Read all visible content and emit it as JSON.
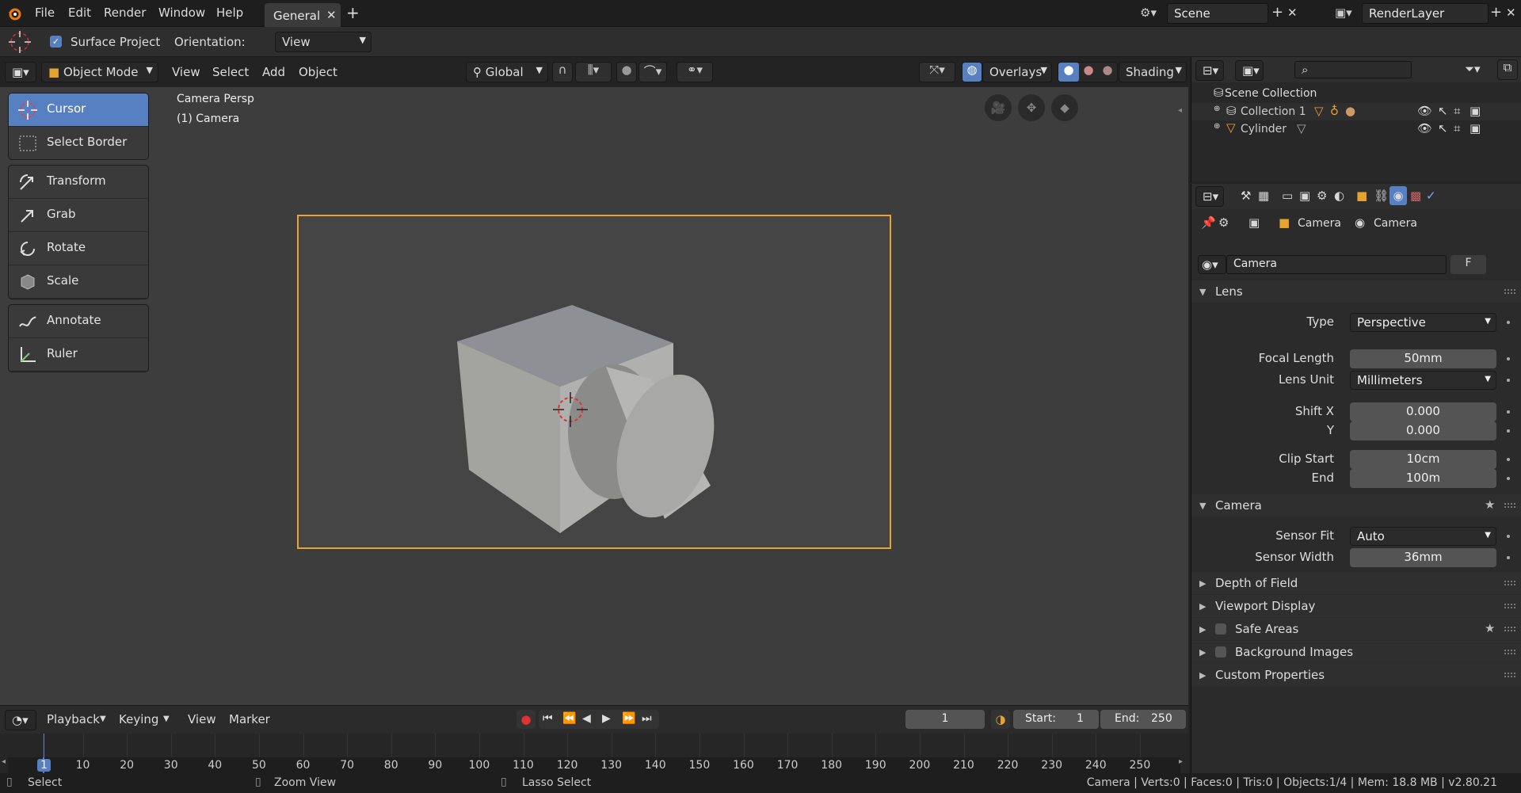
{
  "menu": [
    "File",
    "Edit",
    "Render",
    "Window",
    "Help"
  ],
  "workspace_tab": "General",
  "scene": "Scene",
  "render_layer": "RenderLayer",
  "tool_header": {
    "surface_project": "Surface Project",
    "orientation_label": "Orientation:",
    "orientation_value": "View"
  },
  "viewport_header": {
    "mode": "Object Mode",
    "menus": [
      "View",
      "Select",
      "Add",
      "Object"
    ],
    "transform_orientation": "Global",
    "overlays": "Overlays",
    "shading": "Shading"
  },
  "viewport": {
    "line1": "Camera Persp",
    "line2": "(1) Camera"
  },
  "tools": {
    "group1": [
      "Cursor",
      "Select Border"
    ],
    "group2": [
      "Transform",
      "Grab",
      "Rotate",
      "Scale"
    ],
    "group3": [
      "Annotate",
      "Ruler"
    ]
  },
  "outliner": {
    "scene_collection": "Scene Collection",
    "collection": "Collection 1",
    "object": "Cylinder"
  },
  "properties": {
    "breadcrumb": [
      "Camera",
      "Camera"
    ],
    "datablock": "Camera",
    "fake_user": "F",
    "lens_title": "Lens",
    "type_label": "Type",
    "type_value": "Perspective",
    "focal_label": "Focal Length",
    "focal_value": "50mm",
    "unit_label": "Lens Unit",
    "unit_value": "Millimeters",
    "shiftx_label": "Shift X",
    "shiftx_value": "0.000",
    "shifty_label": "Y",
    "shifty_value": "0.000",
    "clipstart_label": "Clip Start",
    "clipstart_value": "10cm",
    "clipend_label": "End",
    "clipend_value": "100m",
    "camera_title": "Camera",
    "sensorfit_label": "Sensor Fit",
    "sensorfit_value": "Auto",
    "sensorwidth_label": "Sensor Width",
    "sensorwidth_value": "36mm",
    "collapsed": [
      "Depth of Field",
      "Viewport Display",
      "Safe Areas",
      "Background Images",
      "Custom Properties"
    ]
  },
  "timeline": {
    "menus": [
      "Playback",
      "Keying",
      "View",
      "Marker"
    ],
    "current_frame": "1",
    "start_label": "Start:",
    "start": "1",
    "end_label": "End:",
    "end": "250",
    "ticks": [
      "1",
      "10",
      "20",
      "30",
      "40",
      "50",
      "60",
      "70",
      "80",
      "90",
      "100",
      "110",
      "120",
      "130",
      "140",
      "150",
      "160",
      "170",
      "180",
      "190",
      "200",
      "210",
      "220",
      "230",
      "240",
      "250"
    ]
  },
  "status": {
    "left1": "Select",
    "left2": "Zoom View",
    "left3": "Lasso Select",
    "right": "Camera | Verts:0 | Faces:0 | Tris:0 | Objects:1/4 | Mem: 18.8 MB | v2.80.21"
  },
  "colors": {
    "accent": "#5680c2",
    "camera_frame": "#e7a330",
    "record": "#d33"
  }
}
